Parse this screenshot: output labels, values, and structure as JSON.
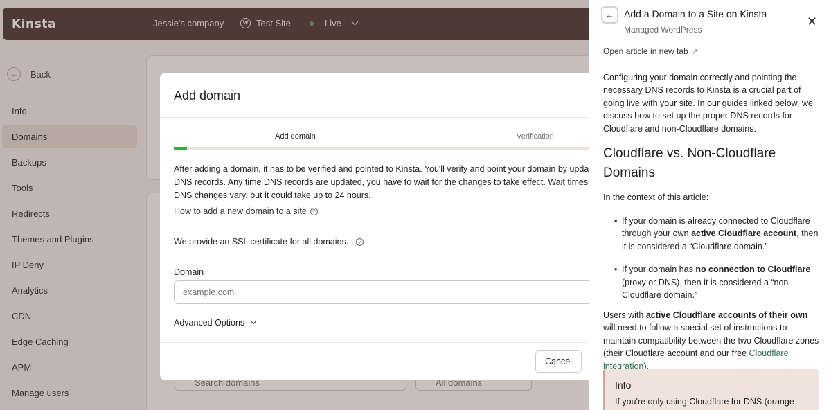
{
  "topbar": {
    "logo": "Kinsta",
    "company": "Jessie's company",
    "site": "Test Site",
    "environment": "Live"
  },
  "sidebar": {
    "back_label": "Back",
    "items": [
      {
        "label": "Info",
        "active": false
      },
      {
        "label": "Domains",
        "active": true
      },
      {
        "label": "Backups",
        "active": false
      },
      {
        "label": "Tools",
        "active": false
      },
      {
        "label": "Redirects",
        "active": false
      },
      {
        "label": "Themes and Plugins",
        "active": false
      },
      {
        "label": "IP Deny",
        "active": false
      },
      {
        "label": "Analytics",
        "active": false
      },
      {
        "label": "CDN",
        "active": false
      },
      {
        "label": "Edge Caching",
        "active": false
      },
      {
        "label": "APM",
        "active": false
      },
      {
        "label": "Manage users",
        "active": false
      }
    ]
  },
  "background": {
    "search_placeholder": "Search domains",
    "filter_value": "All domains"
  },
  "modal": {
    "title": "Add domain",
    "steps": [
      "Add domain",
      "Verification"
    ],
    "progress_fraction": 0.03,
    "intro": "After adding a domain, it has to be verified and pointed to Kinsta. You'll verify and point your domain by updating DNS records. Any time DNS records are updated, you have to wait for the changes to take effect. Wait times for DNS changes vary, but it could take up to 24 hours.",
    "howto_link": "How to add a new domain to a site",
    "ssl_note": "We provide an SSL certificate for all domains.",
    "domain_label": "Domain",
    "domain_placeholder": "example.com",
    "advanced_label": "Advanced Options",
    "cancel_label": "Cancel"
  },
  "drawer": {
    "title": "Add a Domain to a Site on Kinsta",
    "subtitle": "Managed WordPress",
    "open_new_tab": "Open article in new tab",
    "intro": "Configuring your domain correctly and pointing the necessary DNS records to Kinsta is a crucial part of going live with your site. In our guides linked below, we discuss how to set up the proper DNS records for Cloudflare and non-Cloudflare domains.",
    "heading": "Cloudflare vs. Non-Cloudflare Domains",
    "context": "In the context of this article:",
    "bullet1": {
      "pre": "If your domain is already connected to Cloudflare through your own ",
      "bold": "active Cloudflare account",
      "post": ", then it is considered a “Cloudflare domain.”"
    },
    "bullet2": {
      "pre": "If your domain has ",
      "bold": "no connection to Cloudflare",
      "post": " (proxy or DNS), then it is considered a “non-Cloudflare domain.”"
    },
    "users": {
      "pre": "Users with ",
      "bold": "active Cloudflare accounts of their own",
      "mid": " will need to follow a special set of instructions to maintain compatibility between the two Cloudflare zones (their Cloudflare account and our free ",
      "link": "Cloudflare integration",
      "post": ")."
    },
    "info_title": "Info",
    "info_text": "If you're only using Cloudflare for DNS (orange"
  }
}
